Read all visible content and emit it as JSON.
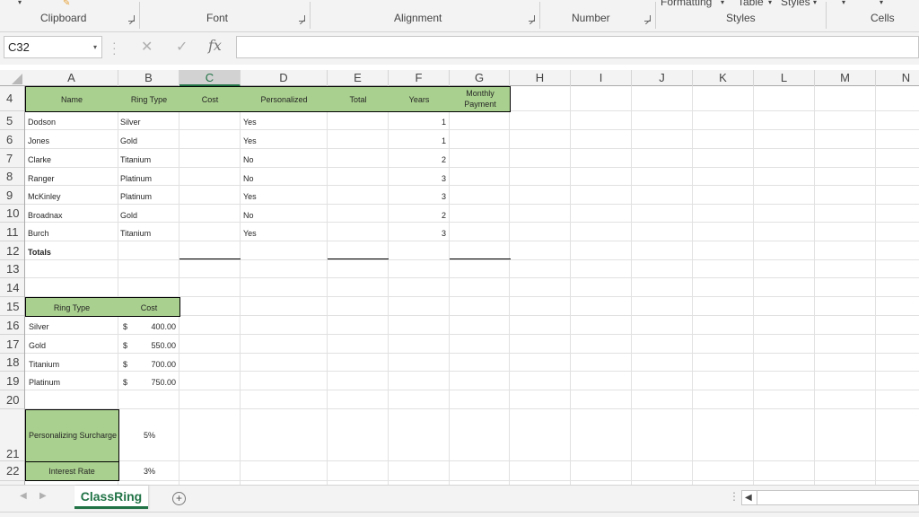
{
  "ribbon": {
    "top_items": [
      "Formatting",
      "Table",
      "Styles"
    ],
    "groups": [
      "Clipboard",
      "Font",
      "Alignment",
      "Number",
      "Styles",
      "Cells"
    ]
  },
  "formula_bar": {
    "name_box": "C32",
    "fx_label": "fx",
    "formula": ""
  },
  "columns": [
    "A",
    "B",
    "C",
    "D",
    "E",
    "F",
    "G",
    "H",
    "I",
    "J",
    "K",
    "L",
    "M",
    "N"
  ],
  "selected_column": "C",
  "rows": [
    "4",
    "5",
    "6",
    "7",
    "8",
    "9",
    "10",
    "11",
    "12",
    "13",
    "14",
    "15",
    "16",
    "17",
    "18",
    "19",
    "20",
    "21",
    "22"
  ],
  "main_table": {
    "headers": [
      "Name",
      "Ring Type",
      "Cost",
      "Personalized",
      "Total",
      "Years",
      "Monthly Payment"
    ],
    "rows": [
      {
        "name": "Dodson",
        "ring": "Silver",
        "personalized": "Yes",
        "years": "1"
      },
      {
        "name": "Jones",
        "ring": "Gold",
        "personalized": "Yes",
        "years": "1"
      },
      {
        "name": "Clarke",
        "ring": "Titanium",
        "personalized": "No",
        "years": "2"
      },
      {
        "name": "Ranger",
        "ring": "Platinum",
        "personalized": "No",
        "years": "3"
      },
      {
        "name": "McKinley",
        "ring": "Platinum",
        "personalized": "Yes",
        "years": "3"
      },
      {
        "name": "Broadnax",
        "ring": "Gold",
        "personalized": "No",
        "years": "2"
      },
      {
        "name": "Burch",
        "ring": "Titanium",
        "personalized": "Yes",
        "years": "3"
      }
    ],
    "totals_label": "Totals"
  },
  "cost_table": {
    "headers": [
      "Ring Type",
      "Cost"
    ],
    "currency": "$",
    "rows": [
      {
        "type": "Silver",
        "cost": "400.00"
      },
      {
        "type": "Gold",
        "cost": "550.00"
      },
      {
        "type": "Titanium",
        "cost": "700.00"
      },
      {
        "type": "Platinum",
        "cost": "750.00"
      }
    ]
  },
  "surcharge": {
    "label": "Personalizing Surcharge",
    "value": "5%"
  },
  "interest": {
    "label": "Interest Rate",
    "value": "3%"
  },
  "sheet_tab": "ClassRing",
  "add_sheet": "+",
  "colors": {
    "header_fill": "#a9d08e",
    "accent": "#217346"
  }
}
